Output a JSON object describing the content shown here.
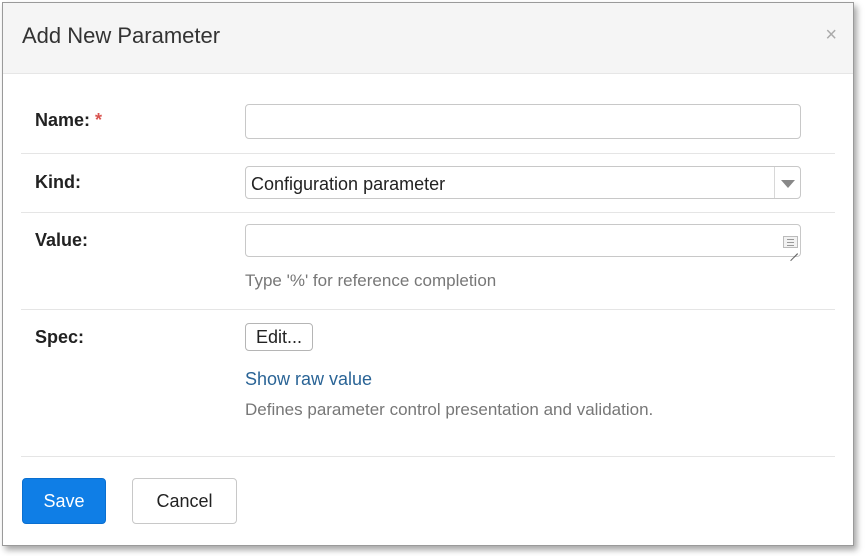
{
  "dialog": {
    "title": "Add New Parameter",
    "close_glyph": "×"
  },
  "form": {
    "name": {
      "label": "Name:",
      "required_mark": "*",
      "value": ""
    },
    "kind": {
      "label": "Kind:",
      "selected": "Configuration parameter"
    },
    "value": {
      "label": "Value:",
      "value": "",
      "help": "Type '%' for reference completion"
    },
    "spec": {
      "label": "Spec:",
      "edit_label": "Edit...",
      "raw_link": "Show raw value",
      "help": "Defines parameter control presentation and validation."
    }
  },
  "footer": {
    "save_label": "Save",
    "cancel_label": "Cancel"
  },
  "colors": {
    "primary": "#0f7ee6",
    "link": "#2a6496",
    "required": "#d9534f"
  }
}
